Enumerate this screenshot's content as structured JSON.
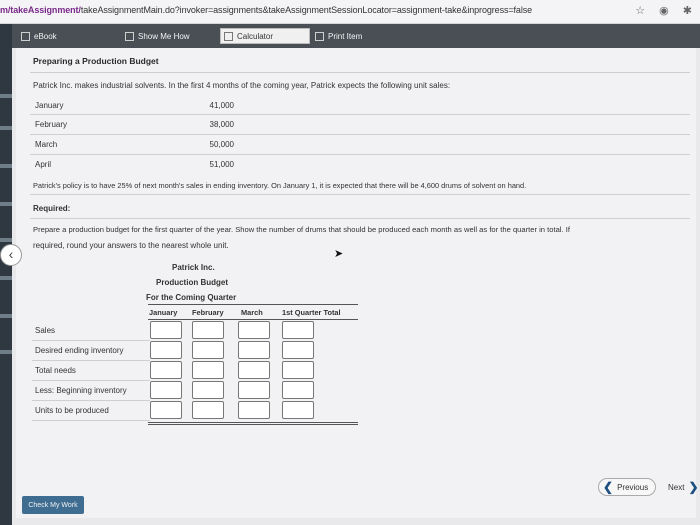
{
  "browser": {
    "url_prefix": "m/takeAssignment/",
    "url_main": "takeAssignmentMain.do?invoker=assignments&takeAssignmentSessionLocator=assignment-take&inprogress=false",
    "icons": [
      "star-icon",
      "extension-icon",
      "menu-icon"
    ]
  },
  "toolbar": {
    "ebook": "eBook",
    "show_me_how": "Show Me How",
    "calculator": "Calculator",
    "print_item": "Print Item"
  },
  "problem": {
    "title": "Preparing a Production Budget",
    "intro": "Patrick Inc. makes industrial solvents. In the first 4 months of the coming year, Patrick expects the following unit sales:",
    "sales": [
      {
        "month": "January",
        "units": "41,000"
      },
      {
        "month": "February",
        "units": "38,000"
      },
      {
        "month": "March",
        "units": "50,000"
      },
      {
        "month": "April",
        "units": "51,000"
      }
    ],
    "policy": "Patrick's policy is to have 25% of next month's sales in ending inventory. On January 1, it is expected that there will be 4,600 drums of solvent on hand.",
    "required_label": "Required:",
    "instruction_line1": "Prepare a production budget for the first quarter of the year. Show the number of drums that should be produced each month as well as for the quarter in total. If",
    "instruction_line2": "required, round your answers to the nearest whole unit."
  },
  "budget": {
    "company": "Patrick Inc.",
    "title": "Production Budget",
    "period": "For the Coming Quarter",
    "columns": [
      "January",
      "February",
      "March",
      "1st Quarter Total"
    ],
    "rows": [
      "Sales",
      "Desired ending inventory",
      "Total needs",
      "Less: Beginning inventory",
      "Units to be produced"
    ]
  },
  "footer": {
    "check": "Check My Work",
    "previous": "Previous",
    "next": "Next"
  }
}
